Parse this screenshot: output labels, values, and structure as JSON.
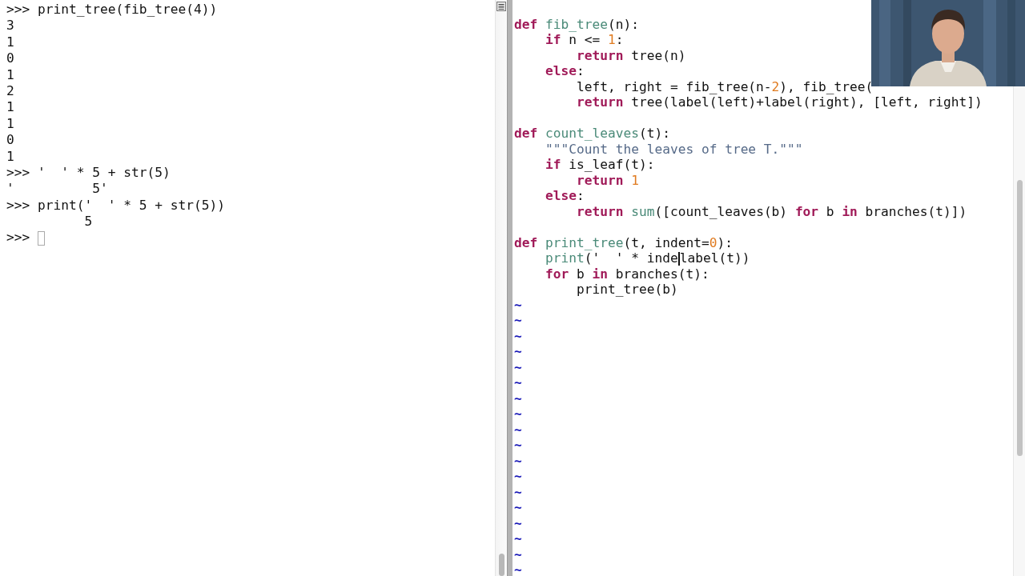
{
  "terminal": {
    "lines": [
      {
        "kind": "input",
        "prompt": ">>>",
        "text": "print_tree(fib_tree(4))"
      },
      {
        "kind": "output",
        "text": "3"
      },
      {
        "kind": "output",
        "text": "1"
      },
      {
        "kind": "output",
        "text": "0"
      },
      {
        "kind": "output",
        "text": "1"
      },
      {
        "kind": "output",
        "text": "2"
      },
      {
        "kind": "output",
        "text": "1"
      },
      {
        "kind": "output",
        "text": "1"
      },
      {
        "kind": "output",
        "text": "0"
      },
      {
        "kind": "output",
        "text": "1"
      },
      {
        "kind": "input",
        "prompt": ">>>",
        "text": "'  ' * 5 + str(5)"
      },
      {
        "kind": "output",
        "text": "'          5'"
      },
      {
        "kind": "input",
        "prompt": ">>>",
        "text": "print('  ' * 5 + str(5))"
      },
      {
        "kind": "output",
        "text": "          5"
      },
      {
        "kind": "prompt",
        "prompt": ">>>",
        "cursor": true
      }
    ]
  },
  "editor": {
    "lines": [
      {
        "kind": "blank"
      },
      {
        "kind": "code",
        "tokens": [
          {
            "kind": "kw",
            "text": "def "
          },
          {
            "kind": "fn",
            "text": "fib_tree"
          },
          {
            "kind": "plain",
            "text": "(n):"
          }
        ]
      },
      {
        "kind": "code",
        "tokens": [
          {
            "kind": "kw",
            "text": "    if"
          },
          {
            "kind": "plain",
            "text": " n <= "
          },
          {
            "kind": "num",
            "text": "1"
          },
          {
            "kind": "plain",
            "text": ":"
          }
        ]
      },
      {
        "kind": "code",
        "tokens": [
          {
            "kind": "kw",
            "text": "        return"
          },
          {
            "kind": "plain",
            "text": " tree(n)"
          }
        ]
      },
      {
        "kind": "code",
        "tokens": [
          {
            "kind": "kw",
            "text": "    else"
          },
          {
            "kind": "plain",
            "text": ":"
          }
        ]
      },
      {
        "kind": "code",
        "tokens": [
          {
            "kind": "plain",
            "text": "        left, right = fib_tree(n-"
          },
          {
            "kind": "num",
            "text": "2"
          },
          {
            "kind": "plain",
            "text": "), fib_tree("
          }
        ]
      },
      {
        "kind": "code",
        "tokens": [
          {
            "kind": "kw",
            "text": "        return"
          },
          {
            "kind": "plain",
            "text": " tree(label(left)+label(right), [left, right])"
          }
        ]
      },
      {
        "kind": "blank"
      },
      {
        "kind": "code",
        "tokens": [
          {
            "kind": "kw",
            "text": "def "
          },
          {
            "kind": "fn",
            "text": "count_leaves"
          },
          {
            "kind": "plain",
            "text": "(t):"
          }
        ]
      },
      {
        "kind": "code",
        "tokens": [
          {
            "kind": "str",
            "text": "    \"\"\"Count the leaves of tree T.\"\"\""
          }
        ]
      },
      {
        "kind": "code",
        "tokens": [
          {
            "kind": "kw",
            "text": "    if"
          },
          {
            "kind": "plain",
            "text": " is_leaf(t):"
          }
        ]
      },
      {
        "kind": "code",
        "tokens": [
          {
            "kind": "kw",
            "text": "        return "
          },
          {
            "kind": "num",
            "text": "1"
          }
        ]
      },
      {
        "kind": "code",
        "tokens": [
          {
            "kind": "kw",
            "text": "    else"
          },
          {
            "kind": "plain",
            "text": ":"
          }
        ]
      },
      {
        "kind": "code",
        "tokens": [
          {
            "kind": "kw",
            "text": "        return"
          },
          {
            "kind": "fn",
            "text": " sum"
          },
          {
            "kind": "plain",
            "text": "([count_leaves(b) "
          },
          {
            "kind": "kw",
            "text": "for"
          },
          {
            "kind": "plain",
            "text": " b "
          },
          {
            "kind": "kw",
            "text": "in"
          },
          {
            "kind": "plain",
            "text": " branches(t)])"
          }
        ]
      },
      {
        "kind": "blank"
      },
      {
        "kind": "code",
        "tokens": [
          {
            "kind": "kw",
            "text": "def "
          },
          {
            "kind": "fn",
            "text": "print_tree"
          },
          {
            "kind": "plain",
            "text": "(t, indent="
          },
          {
            "kind": "num",
            "text": "0"
          },
          {
            "kind": "plain",
            "text": "):"
          }
        ]
      },
      {
        "kind": "code",
        "tokens": [
          {
            "kind": "fn",
            "text": "    print"
          },
          {
            "kind": "plain",
            "text": "('  ' * inde",
            "cursor_after": true
          },
          {
            "kind": "plain",
            "text": "label(t))"
          }
        ]
      },
      {
        "kind": "code",
        "tokens": [
          {
            "kind": "kw",
            "text": "    for"
          },
          {
            "kind": "plain",
            "text": " b "
          },
          {
            "kind": "kw",
            "text": "in"
          },
          {
            "kind": "plain",
            "text": " branches(t):"
          }
        ]
      },
      {
        "kind": "code",
        "tokens": [
          {
            "kind": "plain",
            "text": "        print_tree(b)"
          }
        ]
      },
      {
        "kind": "tilde",
        "text": "~"
      },
      {
        "kind": "tilde",
        "text": "~"
      },
      {
        "kind": "tilde",
        "text": "~"
      },
      {
        "kind": "tilde",
        "text": "~"
      },
      {
        "kind": "tilde",
        "text": "~"
      },
      {
        "kind": "tilde",
        "text": "~"
      },
      {
        "kind": "tilde",
        "text": "~"
      },
      {
        "kind": "tilde",
        "text": "~"
      },
      {
        "kind": "tilde",
        "text": "~"
      },
      {
        "kind": "tilde",
        "text": "~"
      },
      {
        "kind": "tilde",
        "text": "~"
      },
      {
        "kind": "tilde",
        "text": "~"
      },
      {
        "kind": "tilde",
        "text": "~"
      },
      {
        "kind": "tilde",
        "text": "~"
      },
      {
        "kind": "tilde",
        "text": "~"
      },
      {
        "kind": "tilde",
        "text": "~"
      },
      {
        "kind": "tilde",
        "text": "~"
      },
      {
        "kind": "tilde",
        "text": "~"
      }
    ]
  }
}
